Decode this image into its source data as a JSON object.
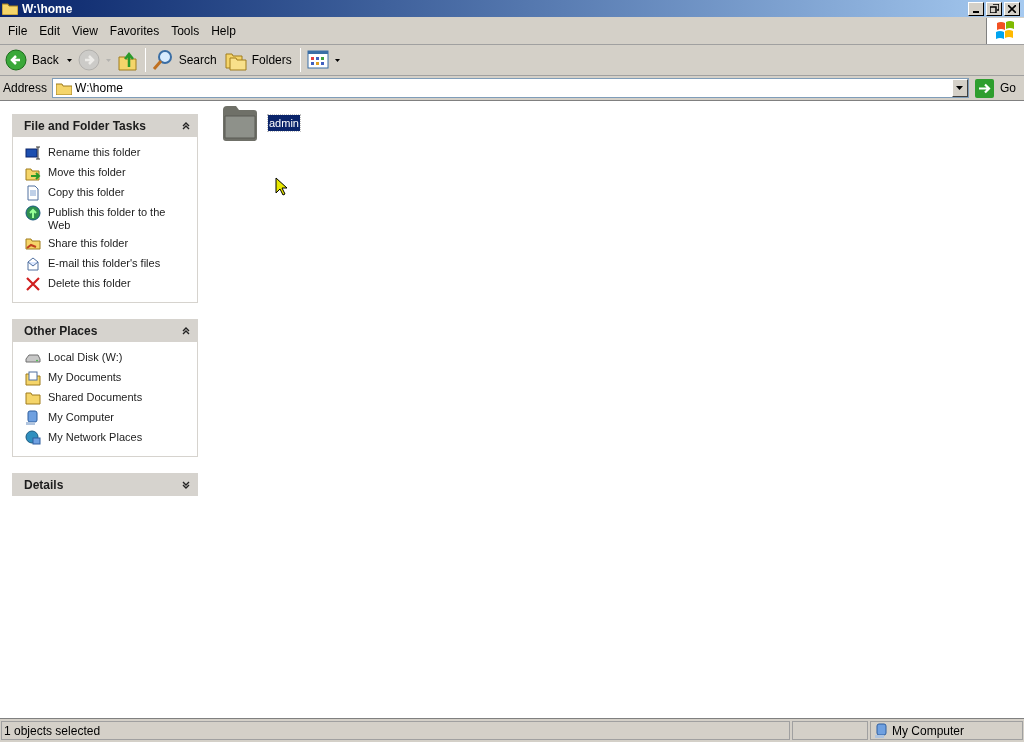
{
  "window": {
    "title": "W:\\home"
  },
  "menu": [
    "File",
    "Edit",
    "View",
    "Favorites",
    "Tools",
    "Help"
  ],
  "toolbar": [
    {
      "kind": "back",
      "label": "Back",
      "disabled": false
    },
    {
      "kind": "forward",
      "disabled": true
    },
    {
      "kind": "up",
      "disabled": false
    },
    {
      "kind": "search",
      "label": "Search",
      "disabled": false
    },
    {
      "kind": "folders",
      "label": "Folders",
      "disabled": false
    },
    {
      "kind": "views",
      "disabled": false
    }
  ],
  "address": {
    "label": "Address",
    "value": "W:\\home",
    "go": "Go"
  },
  "panels": [
    {
      "title": "File and Folder Tasks",
      "expanded": true,
      "items": [
        {
          "kind": "rename",
          "label": "Rename this folder"
        },
        {
          "kind": "move",
          "label": "Move this folder"
        },
        {
          "kind": "copy",
          "label": "Copy this folder"
        },
        {
          "kind": "publish",
          "label": "Publish this folder to the Web"
        },
        {
          "kind": "share",
          "label": "Share this folder"
        },
        {
          "kind": "email",
          "label": "E-mail this folder's files"
        },
        {
          "kind": "delete",
          "label": "Delete this folder"
        }
      ]
    },
    {
      "title": "Other Places",
      "expanded": true,
      "items": [
        {
          "kind": "disk",
          "label": "Local Disk (W:)"
        },
        {
          "kind": "documents",
          "label": "My Documents"
        },
        {
          "kind": "folder",
          "label": "Shared Documents"
        },
        {
          "kind": "computer",
          "label": "My Computer"
        },
        {
          "kind": "network",
          "label": "My Network Places"
        }
      ]
    },
    {
      "title": "Details",
      "expanded": false
    }
  ],
  "files": [
    {
      "name": "admin",
      "selected": true
    }
  ],
  "status_bar": {
    "text": "1 objects selected",
    "zone": "My Computer"
  }
}
